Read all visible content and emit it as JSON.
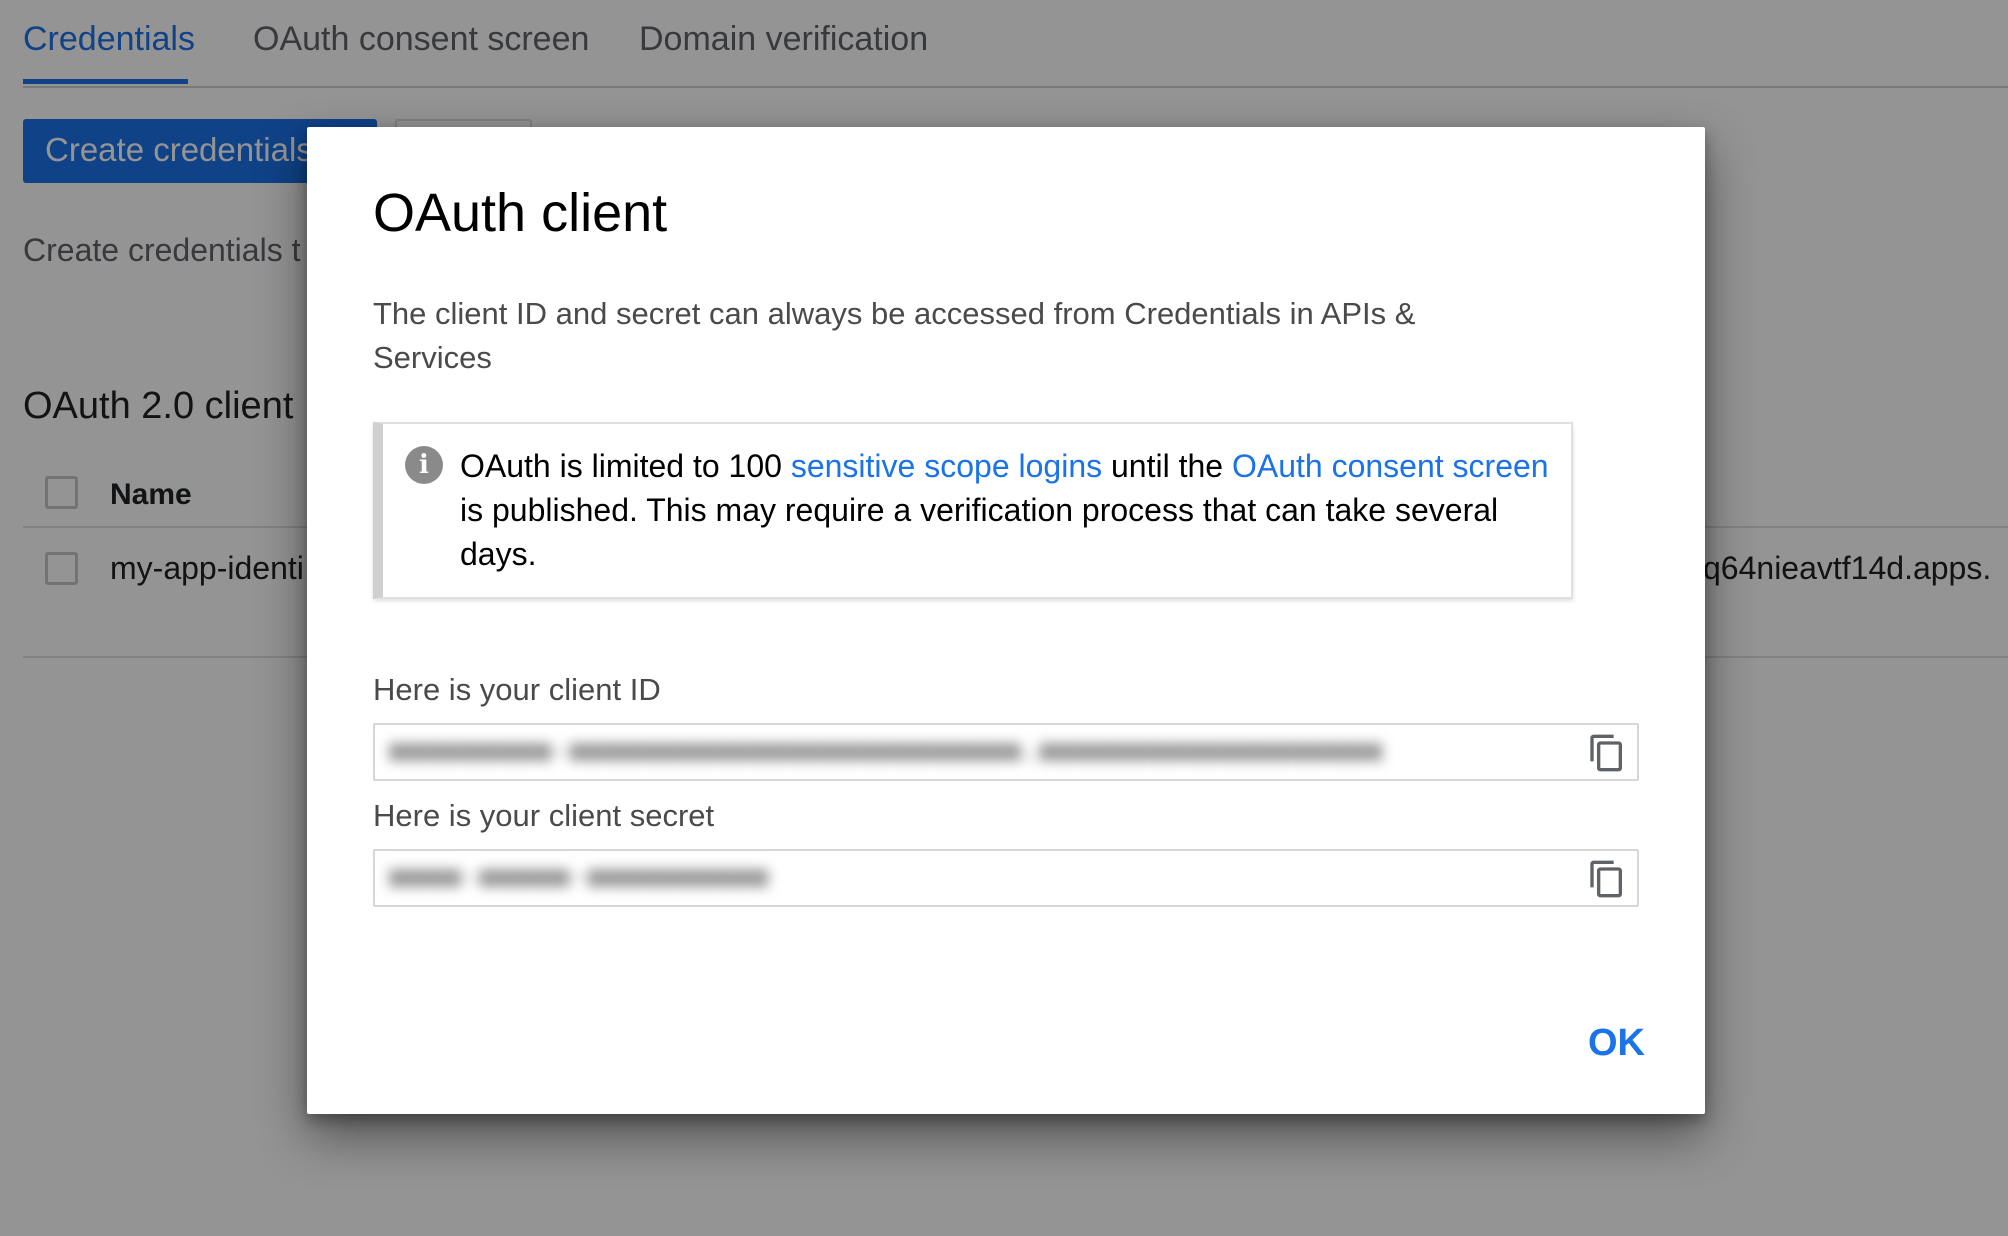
{
  "tabs": [
    {
      "label": "Credentials",
      "active": true
    },
    {
      "label": "OAuth consent screen",
      "active": false
    },
    {
      "label": "Domain verification",
      "active": false
    }
  ],
  "toolbar": {
    "create_label": "Create credentials"
  },
  "page": {
    "helper_text": "Create credentials t",
    "section_title": "OAuth 2.0 client I",
    "table": {
      "columns": [
        "Name"
      ],
      "rows": [
        {
          "name": "my-app-identi",
          "client_id": "q64nieavtf14d.apps."
        }
      ]
    }
  },
  "dialog": {
    "title": "OAuth client",
    "description": "The client ID and secret can always be accessed from Credentials in APIs & Services",
    "notice": {
      "text_1": "OAuth is limited to 100 ",
      "link_1": "sensitive scope logins",
      "text_2": " until the ",
      "link_2": "OAuth consent screen",
      "text_3": " is published. This may require a verification process that can take several days."
    },
    "client_id_label": "Here is your client ID",
    "client_id_value": "■■■■■■■■■-■■■■■■■■■■■■■■■■■■■■■■■■■.■■■■■■■■■■■■■■■■■■■",
    "client_secret_label": "Here is your client secret",
    "client_secret_value": "■■■■-■■■■■-■■■■■■■■■■",
    "ok_label": "OK"
  },
  "colors": {
    "accent": "#1a73e8",
    "scrim": "rgba(0,0,0,0.42)"
  },
  "icons": [
    "info-icon",
    "copy-icon"
  ]
}
